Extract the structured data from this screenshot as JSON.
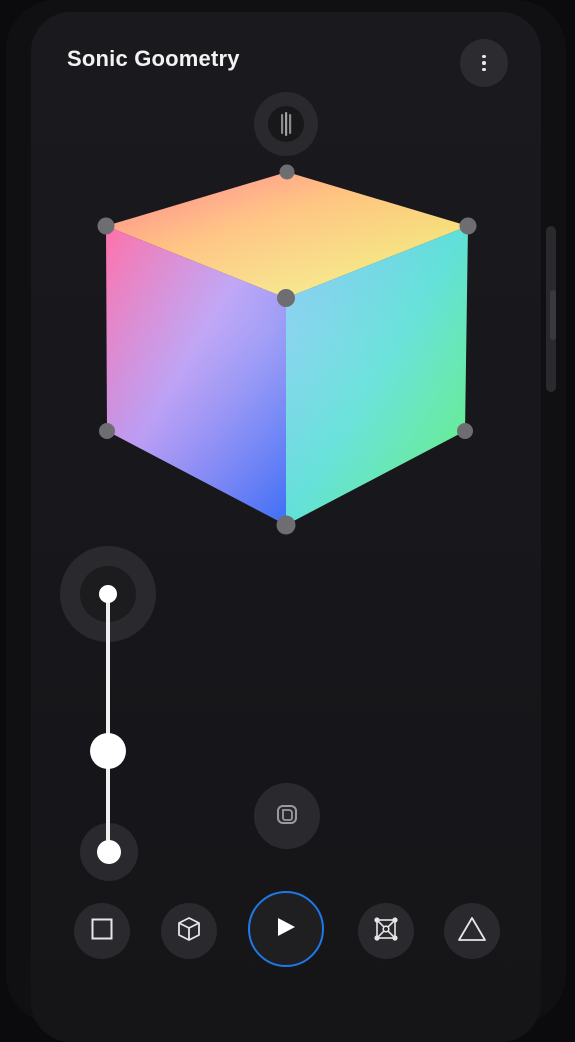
{
  "app": {
    "title": "Sonic Goometry"
  },
  "header": {
    "menu_icon": "more-vertical-icon"
  },
  "colors": {
    "background": "#17171b",
    "button": "#2a2a2e",
    "accent": "#1e78e6",
    "vertex": "#6e6e72",
    "text": "#f2f2f2"
  },
  "slider": {
    "value_fraction": 0.39
  },
  "toolbar": {
    "buttons": [
      {
        "icon": "square-icon"
      },
      {
        "icon": "cube-icon"
      },
      {
        "icon": "play-icon",
        "active": true
      },
      {
        "icon": "transform-icon"
      },
      {
        "icon": "triangle-icon"
      }
    ]
  },
  "controls": {
    "top_knob_icon": "rotate-handle-icon",
    "center_icon": "object-icon"
  }
}
